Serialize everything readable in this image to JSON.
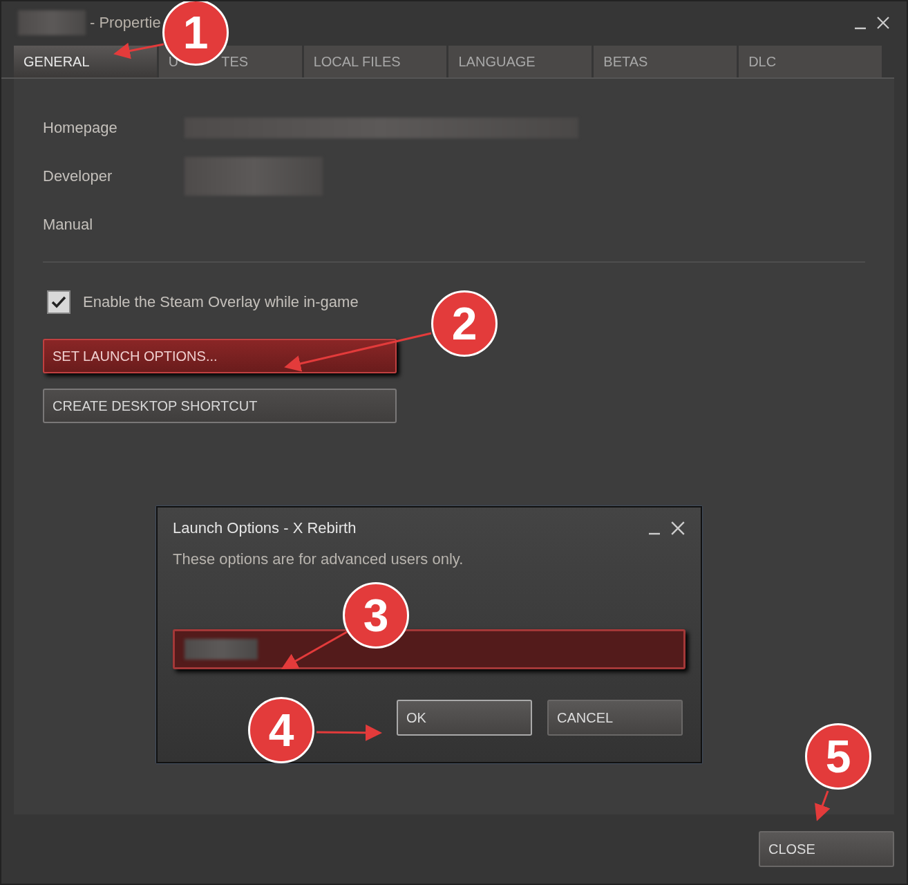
{
  "window": {
    "title": "- Propertie"
  },
  "tabs": [
    {
      "label": "GENERAL",
      "selected": true
    },
    {
      "label": "U",
      "label_tail": "TES",
      "selected": false
    },
    {
      "label": "LOCAL FILES",
      "selected": false
    },
    {
      "label": "LANGUAGE",
      "selected": false
    },
    {
      "label": "BETAS",
      "selected": false
    },
    {
      "label": "DLC",
      "selected": false
    }
  ],
  "info_rows": [
    {
      "label": "Homepage"
    },
    {
      "label": "Developer"
    },
    {
      "label": "Manual"
    }
  ],
  "overlay_checkbox": {
    "label": "Enable the Steam Overlay while in-game",
    "checked": true
  },
  "buttons": [
    {
      "label": "SET LAUNCH OPTIONS...",
      "highlighted": true
    },
    {
      "label": "CREATE DESKTOP SHORTCUT",
      "highlighted": false
    }
  ],
  "dialog": {
    "title": "Launch Options - X Rebirth",
    "message": "These options are for advanced users only.",
    "field_highlighted": true,
    "buttons": [
      {
        "label": "OK",
        "focused": true
      },
      {
        "label": "CANCEL",
        "focused": false
      }
    ]
  },
  "close_button": {
    "label": "CLOSE"
  },
  "annotations": [
    {
      "label": "1"
    },
    {
      "label": "2"
    },
    {
      "label": "3"
    },
    {
      "label": "4"
    },
    {
      "label": "5"
    }
  ]
}
